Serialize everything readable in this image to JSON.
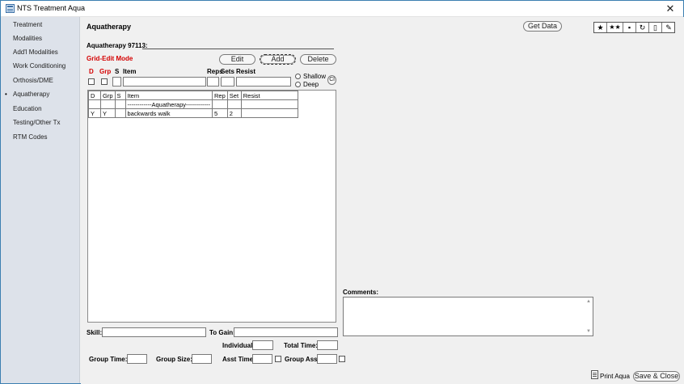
{
  "window": {
    "title": "NTS Treatment Aqua",
    "close_glyph": "✕"
  },
  "sidebar": {
    "items": [
      {
        "label": "Treatment"
      },
      {
        "label": "Modalities"
      },
      {
        "label": "Add'l Modalities"
      },
      {
        "label": "Work Conditioning"
      },
      {
        "label": "Orthosis/DME"
      },
      {
        "label": "Aquatherapy",
        "selected": true,
        "bullet": "•"
      },
      {
        "label": "Education"
      },
      {
        "label": "Testing/Other Tx"
      },
      {
        "label": "RTM Codes"
      }
    ]
  },
  "header": {
    "title": "Aquatherapy",
    "get_data_label": "Get Data",
    "toolbar_icons": [
      "star-icon",
      "double-star-icon",
      "save-icon",
      "refresh-icon",
      "clipboard-icon",
      "eraser-icon"
    ]
  },
  "form": {
    "code_label": "Aquatherapy 97113:",
    "mode_label": "Grid-Edit Mode",
    "edit_label": "Edit",
    "add_label": "Add",
    "delete_label": "Delete",
    "col_d": "D",
    "col_grp": "Grp",
    "col_s": "S",
    "col_item": "Item",
    "col_reps": "Reps",
    "col_sets": "Sets",
    "col_resist": "Resist",
    "shallow_label": "Shallow",
    "deep_label": "Deep",
    "cl_label": "Cl"
  },
  "grid": {
    "headers": [
      "D",
      "Grp",
      "S",
      "Item",
      "Rep",
      "Set",
      "Resist"
    ],
    "rows": [
      [
        "",
        "",
        "",
        "------------Aquatherapy------------",
        "",
        "",
        ""
      ],
      [
        "Y",
        "Y",
        "",
        "backwards walk",
        "5",
        "2",
        ""
      ]
    ]
  },
  "fields": {
    "skill_label": "Skill:",
    "to_gain_label": "To Gain:",
    "individual_label": "Individual:",
    "total_time_label": "Total Time:",
    "group_time_label": "Group Time:",
    "group_size_label": "Group Size:",
    "asst_time_label": "Asst Time:",
    "group_asst_label": "Group Asst:",
    "comments_label": "Comments:"
  },
  "footer": {
    "print_label": "Print Aqua",
    "save_close_label": "Save & Close"
  },
  "colors": {
    "accent_red": "#d40000",
    "sidebar_bg": "#dde2ea",
    "window_border": "#3c7fb1"
  }
}
